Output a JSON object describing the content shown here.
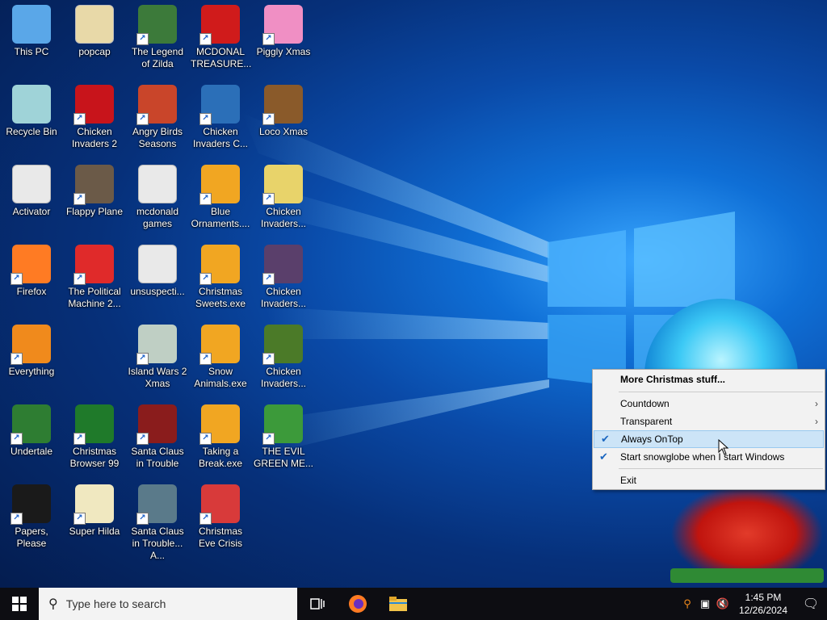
{
  "desktop": {
    "icons": [
      {
        "label": "This PC",
        "icon": "computer-icon",
        "color": "#5aa7e8",
        "shortcut": false
      },
      {
        "label": "popcap",
        "icon": "folder-icon",
        "color": "#e8d9a8",
        "shortcut": false
      },
      {
        "label": "The Legend of Zilda",
        "icon": "game-icon",
        "color": "#3c7a3a",
        "shortcut": true
      },
      {
        "label": "MCDONAL TREASURE...",
        "icon": "mcdonalds-icon",
        "color": "#d01b1b",
        "shortcut": true
      },
      {
        "label": "Piggly Xmas",
        "icon": "pig-icon",
        "color": "#f08fc4",
        "shortcut": true
      },
      {
        "label": "Recycle Bin",
        "icon": "recycle-bin-icon",
        "color": "#9fd3d8",
        "shortcut": false
      },
      {
        "label": "Chicken Invaders 2",
        "icon": "chicken-icon",
        "color": "#c8141b",
        "shortcut": true
      },
      {
        "label": "Angry Birds Seasons",
        "icon": "angry-bird-icon",
        "color": "#c9452a",
        "shortcut": true
      },
      {
        "label": "Chicken Invaders C...",
        "icon": "chicken-icon",
        "color": "#2b6fb8",
        "shortcut": true
      },
      {
        "label": "Loco Xmas",
        "icon": "bear-icon",
        "color": "#8a5a2a",
        "shortcut": true
      },
      {
        "label": "Activator",
        "icon": "file-icon",
        "color": "#e9e9e9",
        "shortcut": false
      },
      {
        "label": "Flappy Plane",
        "icon": "plane-icon",
        "color": "#6b5a48",
        "shortcut": true
      },
      {
        "label": "mcdonald games",
        "icon": "file-icon",
        "color": "#e9e9e9",
        "shortcut": false
      },
      {
        "label": "Blue Ornaments....",
        "icon": "ornaments-icon",
        "color": "#f1a622",
        "shortcut": true
      },
      {
        "label": "Chicken Invaders...",
        "icon": "chicken-icon",
        "color": "#e8d36a",
        "shortcut": true
      },
      {
        "label": "Firefox",
        "icon": "firefox-icon",
        "color": "#ff7b23",
        "shortcut": true
      },
      {
        "label": "The Political Machine 2...",
        "icon": "political-icon",
        "color": "#e02a2a",
        "shortcut": true
      },
      {
        "label": "unsuspecti...",
        "icon": "file-icon",
        "color": "#e9e9e9",
        "shortcut": false
      },
      {
        "label": "Christmas Sweets.exe",
        "icon": "ornaments-icon",
        "color": "#f1a622",
        "shortcut": true
      },
      {
        "label": "Chicken Invaders...",
        "icon": "chicken-icon",
        "color": "#5a3f6b",
        "shortcut": true
      },
      {
        "label": "Everything",
        "icon": "magnifier-icon",
        "color": "#f08a1c",
        "shortcut": true
      },
      {
        "label": "",
        "icon": "",
        "color": "",
        "shortcut": false
      },
      {
        "label": "Island Wars 2 Xmas",
        "icon": "island-icon",
        "color": "#bfcfc4",
        "shortcut": true
      },
      {
        "label": "Snow Animals.exe",
        "icon": "ornaments-icon",
        "color": "#f1a622",
        "shortcut": true
      },
      {
        "label": "Chicken Invaders...",
        "icon": "chicken-icon",
        "color": "#4b7a28",
        "shortcut": true
      },
      {
        "label": "Undertale",
        "icon": "undertale-icon",
        "color": "#2e7d32",
        "shortcut": true
      },
      {
        "label": "Christmas Browser 99",
        "icon": "tree-icon",
        "color": "#1f7a2a",
        "shortcut": true
      },
      {
        "label": "Santa Claus in Trouble",
        "icon": "santa-icon",
        "color": "#8a1c1c",
        "shortcut": true
      },
      {
        "label": "Taking a Break.exe",
        "icon": "ornaments-icon",
        "color": "#f1a622",
        "shortcut": true
      },
      {
        "label": "THE EVIL GREEN ME...",
        "icon": "messenger-icon",
        "color": "#3c9a3a",
        "shortcut": true
      },
      {
        "label": "Papers, Please",
        "icon": "papers-please-icon",
        "color": "#1a1a1a",
        "shortcut": true
      },
      {
        "label": "Super Hilda",
        "icon": "pixel-icon",
        "color": "#f0e8c0",
        "shortcut": true
      },
      {
        "label": "Santa Claus in Trouble... A...",
        "icon": "santa-icon",
        "color": "#5a7a8a",
        "shortcut": true
      },
      {
        "label": "Christmas Eve Crisis",
        "icon": "santa-face-icon",
        "color": "#d83a3a",
        "shortcut": true
      }
    ]
  },
  "context_menu": {
    "items": [
      {
        "label": "More Christmas stuff...",
        "bold": true,
        "checked": false,
        "submenu": false,
        "hover": false
      },
      {
        "separator": true
      },
      {
        "label": "Countdown",
        "bold": false,
        "checked": false,
        "submenu": true,
        "hover": false
      },
      {
        "label": "Transparent",
        "bold": false,
        "checked": false,
        "submenu": true,
        "hover": false
      },
      {
        "label": "Always OnTop",
        "bold": false,
        "checked": true,
        "submenu": false,
        "hover": true
      },
      {
        "label": "Start snowglobe when I start Windows",
        "bold": false,
        "checked": true,
        "submenu": false,
        "hover": false
      },
      {
        "separator": true
      },
      {
        "label": "Exit",
        "bold": false,
        "checked": false,
        "submenu": false,
        "hover": false
      }
    ]
  },
  "taskbar": {
    "search_placeholder": "Type here to search",
    "pinned": [
      "task-view-icon",
      "firefox-icon",
      "file-explorer-icon"
    ],
    "tray": [
      "search-everything-icon",
      "network-icon",
      "volume-muted-icon"
    ],
    "time": "1:45 PM",
    "date": "12/26/2024"
  }
}
